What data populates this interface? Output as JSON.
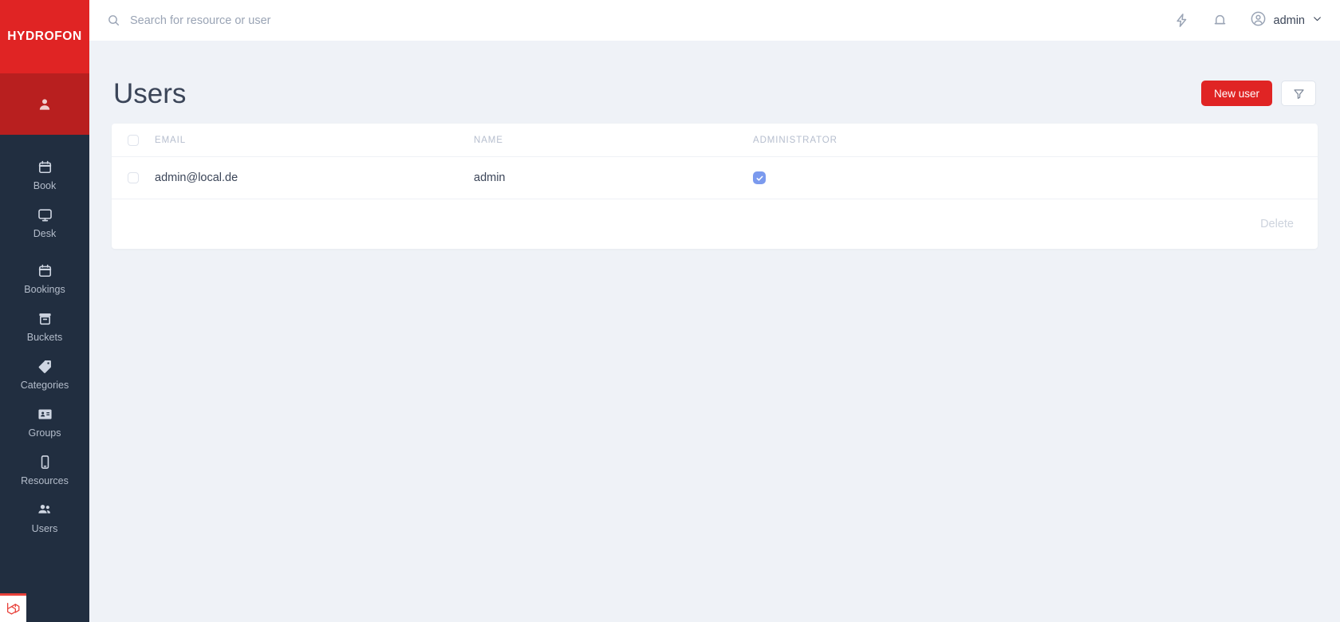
{
  "brand": {
    "name": "HYDROFON"
  },
  "sidebar": {
    "profile_icon": "user-icon",
    "items": [
      {
        "label": "Book",
        "icon": "calendar-icon"
      },
      {
        "label": "Desk",
        "icon": "monitor-icon"
      },
      {
        "label": "Bookings",
        "icon": "calendar-icon"
      },
      {
        "label": "Buckets",
        "icon": "archive-icon"
      },
      {
        "label": "Categories",
        "icon": "tag-icon"
      },
      {
        "label": "Groups",
        "icon": "id-card-icon"
      },
      {
        "label": "Resources",
        "icon": "mobile-icon"
      },
      {
        "label": "Users",
        "icon": "users-icon"
      }
    ],
    "footer_logo": "laravel-logo"
  },
  "topbar": {
    "search": {
      "value": "",
      "placeholder": "Search for resource or user",
      "icon": "search-icon"
    },
    "lightning_icon": "lightning-bolt-icon",
    "bell_icon": "bell-icon",
    "avatar_icon": "user-circle-icon",
    "user_name": "admin",
    "chevron_icon": "chevron-down-icon"
  },
  "page": {
    "title": "Users",
    "new_user_label": "New user",
    "filter_icon": "filter-funnel-icon"
  },
  "table": {
    "columns": [
      "EMAIL",
      "NAME",
      "ADMINISTRATOR"
    ],
    "rows": [
      {
        "email": "admin@local.de",
        "name": "admin",
        "administrator": true
      }
    ],
    "delete_label": "Delete"
  },
  "colors": {
    "brand_red": "#e02424",
    "brand_red_dark": "#b81f1f",
    "sidebar_bg": "#212e40",
    "page_bg": "#eff2f7",
    "text": "#3b4558",
    "muted": "#b6bece",
    "badge_blue": "#7b9aee",
    "laravel_red": "#e8413a"
  }
}
